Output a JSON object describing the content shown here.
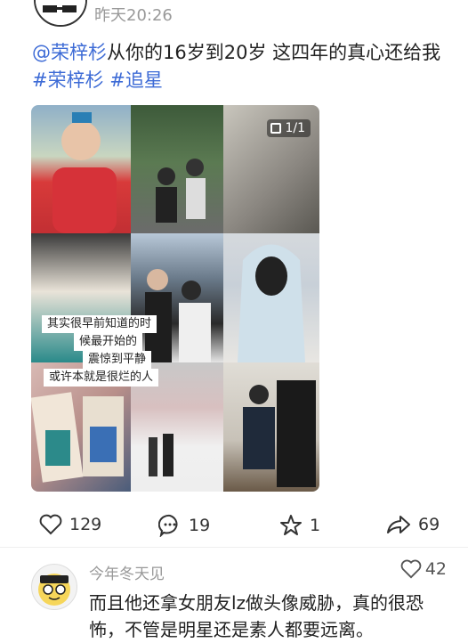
{
  "post": {
    "time": "昨天20:26",
    "text_parts": [
      {
        "text": "@荣梓杉",
        "tag": true
      },
      {
        "text": "从你的16岁到20岁 这四年的真心还给我",
        "tag": false
      },
      {
        "text": "#荣梓杉",
        "tag": true
      },
      {
        "text": " ",
        "tag": false
      },
      {
        "text": "#追星",
        "tag": true
      }
    ],
    "image_counter": "1/1",
    "captions": [
      "其实很早前知道的时",
      "候最开始的",
      "震惊到平静",
      "或许本就是很烂的人"
    ]
  },
  "actions": {
    "likes": "129",
    "comments": "19",
    "favorites": "1",
    "shares": "69"
  },
  "comment": {
    "author": "今年冬天见",
    "likes": "42",
    "text": "而且他还拿女朋友lz做头像威胁，真的很恐怖，不管是明星还是素人都要远离。"
  },
  "colors": {
    "tag": "#3d6bd6",
    "meta": "#999999"
  }
}
